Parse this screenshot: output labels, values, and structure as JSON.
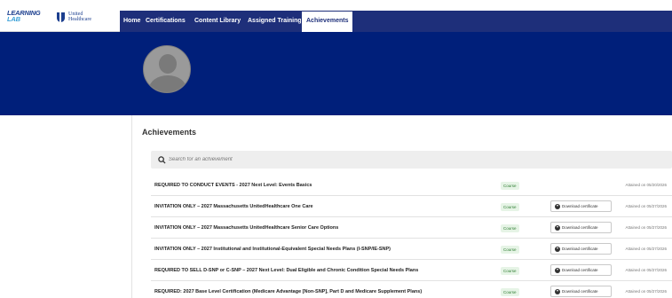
{
  "brand": {
    "logo_line1": "LEARNING",
    "logo_line2": "LAB",
    "partner_line1": "United",
    "partner_line2": "Healthcare"
  },
  "nav": {
    "items": [
      {
        "label": "Home"
      },
      {
        "label": "Certifications"
      },
      {
        "label": "Content Library"
      },
      {
        "label": "Assigned Training"
      },
      {
        "label": "Achievements"
      }
    ],
    "active": "Achievements"
  },
  "profile": {
    "avatar_icon": "default-user-avatar"
  },
  "achievements": {
    "title": "Achievements",
    "search_placeholder": "Search for an achievement",
    "rows": [
      {
        "title": "REQUIRED TO CONDUCT EVENTS - 2027 Next Level: Events Basics",
        "type": "Course",
        "download": "",
        "attained": "Attained on 05/20/2026"
      },
      {
        "title": "INVITATION ONLY – 2027 Massachusetts UnitedHealthcare One Care",
        "type": "Course",
        "download": "Download certificate",
        "attained": "Attained on 05/27/2026"
      },
      {
        "title": "INVITATION ONLY – 2027 Massachusetts UnitedHealthcare Senior Care Options",
        "type": "Course",
        "download": "Download certificate",
        "attained": "Attained on 05/27/2026"
      },
      {
        "title": "INVITATION ONLY – 2027 Institutional and Institutional-Equivalent Special Needs Plans (I-SNP/IE-SNP)",
        "type": "Course",
        "download": "Download certificate",
        "attained": "Attained on 05/27/2026"
      },
      {
        "title": "REQUIRED TO SELL D-SNP or C-SNP – 2027 Next Level: Dual Eligible and Chronic Condition Special Needs Plans",
        "type": "Course",
        "download": "Download certificate",
        "attained": "Attained on 05/27/2026"
      },
      {
        "title": "REQUIRED: 2027 Base Level Certification (Medicare Advantage [Non-SNP], Part D and Medicare Supplement Plans)",
        "type": "Course",
        "download": "Download certificate",
        "attained": "Attained on 05/27/2026"
      }
    ]
  },
  "colors": {
    "nav_bg": "#1e2f7a",
    "banner_bg": "#001f7a",
    "badge_bg": "#e6f4e6",
    "badge_text": "#2e7d32"
  }
}
